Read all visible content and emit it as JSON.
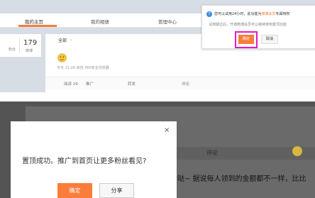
{
  "nav": {
    "tabs": [
      {
        "label": "我的主页"
      },
      {
        "label": "我的相册"
      },
      {
        "label": "管理中心"
      }
    ]
  },
  "stats": {
    "left_label": "粉丝",
    "right_value": "179",
    "right_label": "微博"
  },
  "post": {
    "filter_label": "全部",
    "meta": "今天 11:26 来自 360安全浏览器",
    "actions": {
      "read": "阅读 29",
      "promote": "推广",
      "forward": "转发",
      "comment": "评论"
    }
  },
  "tooltip": {
    "line1_prefix": "您可以试用24小时，此功能为",
    "line1_highlight": "微博会员",
    "line1_suffix": "专属特权",
    "line2": "试用期过后，开通微博会员可以继续使用置顶功能",
    "confirm_label": "确定",
    "cancel_label": "取消"
  },
  "background_post": {
    "comment_label": "评论",
    "text": "哒~ 据说每人领到的金额都不一样，比比"
  },
  "modal": {
    "close_glyph": "×",
    "message": "置顶成功。推广到首页让更多粉丝看见?",
    "confirm_label": "确定",
    "share_label": "分享"
  },
  "colors": {
    "accent": "#fa7d3c",
    "highlight_frame": "#e418c6",
    "info_icon": "#3d8fe0"
  }
}
